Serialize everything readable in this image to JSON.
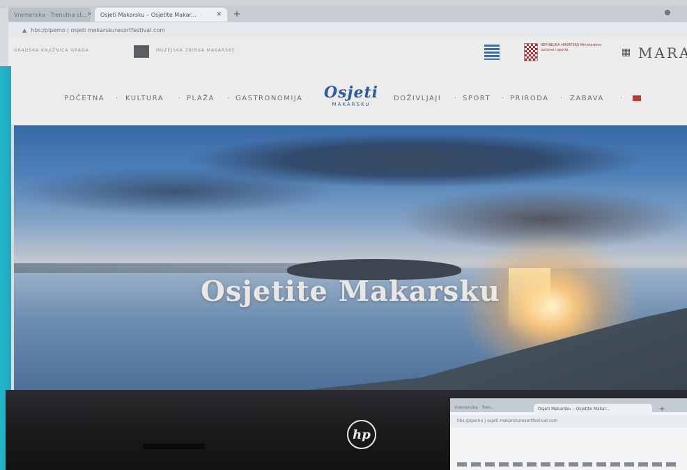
{
  "browser": {
    "tabs": [
      {
        "label": "Vremenska · Trenutna st..."
      },
      {
        "label": "Osjeti Makarsku – Osjetite Makar..."
      }
    ],
    "new_tab": "+",
    "url": "hbs:/pipemo | osjeti makarskuresortfestival.com"
  },
  "site": {
    "partner_text": "GRADSKA KNJIŽNICA GRADA",
    "library_text": "MUZEJSKA ZBIRKA MAKARSKE",
    "ministry_text": "REPUBLIKA HRVATSKA Ministarstvo turizma i sporta",
    "mara_text": "MARA",
    "brand_main": "Osjeti",
    "brand_sub": "MAKARSKU",
    "nav_left": [
      "POČETNA",
      "KULTURA",
      "PLAŽA",
      "GASTRONOMIJA"
    ],
    "nav_right": [
      "DOŽIVLJAJI",
      "SPORT",
      "PRIRODA",
      "ZABAVA"
    ]
  },
  "hero": {
    "title": "Osjetite Makarsku"
  },
  "laptop": {
    "logo": "hp"
  },
  "screen2": {
    "tab1": "Vremenska · Tren...",
    "tab2": "Osjeti Makarsku – Osjetite Makar...",
    "plus": "+",
    "url": "hbs:/pipemo | osjeti makarskuresortfestival.com"
  },
  "colors": {
    "brand_blue": "#2c5aa0",
    "nav_separator": "#c45a6a",
    "teal_panel": "#1fb6cc"
  }
}
